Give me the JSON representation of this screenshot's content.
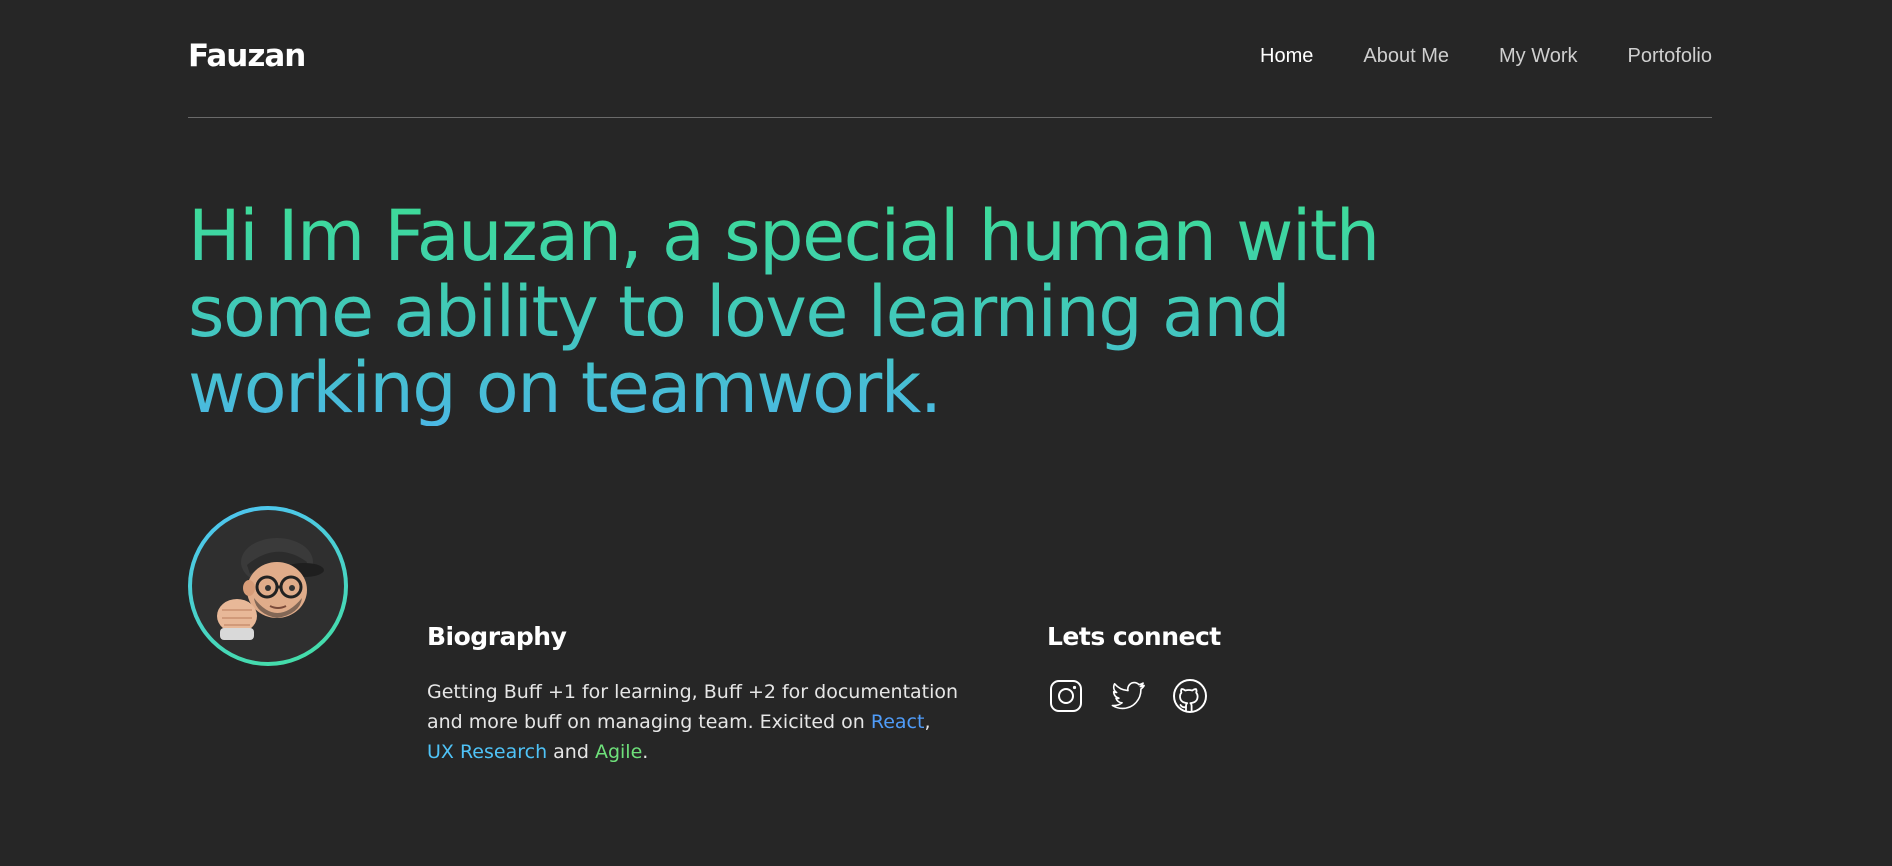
{
  "header": {
    "brand": "Fauzan",
    "nav": [
      {
        "label": "Home",
        "active": true
      },
      {
        "label": "About Me",
        "active": false
      },
      {
        "label": "My Work",
        "active": false
      },
      {
        "label": "Portofolio",
        "active": false
      }
    ]
  },
  "hero": {
    "line1": "Hi Im Fauzan, a special human with",
    "line2": "some ability to love learning and",
    "line3": "working on teamwork."
  },
  "biography": {
    "title": "Biography",
    "text_before": "Getting Buff +1 for learning, Buff +2 for documentation and more buff on managing team. Exicited on ",
    "highlight_react": "React",
    "sep1": ",",
    "highlight_ux": "UX Research",
    "sep2": " and ",
    "highlight_agile": "Agile",
    "text_end": "."
  },
  "connect": {
    "title": "Lets connect",
    "icons": [
      "instagram-icon",
      "twitter-icon",
      "github-icon"
    ]
  },
  "colors": {
    "background": "#262626",
    "gradient_start": "#3ddc97",
    "gradient_end": "#4bb8e4",
    "react": "#4f9cf9",
    "ux_research": "#4fc3f7",
    "agile": "#6ee07a"
  }
}
